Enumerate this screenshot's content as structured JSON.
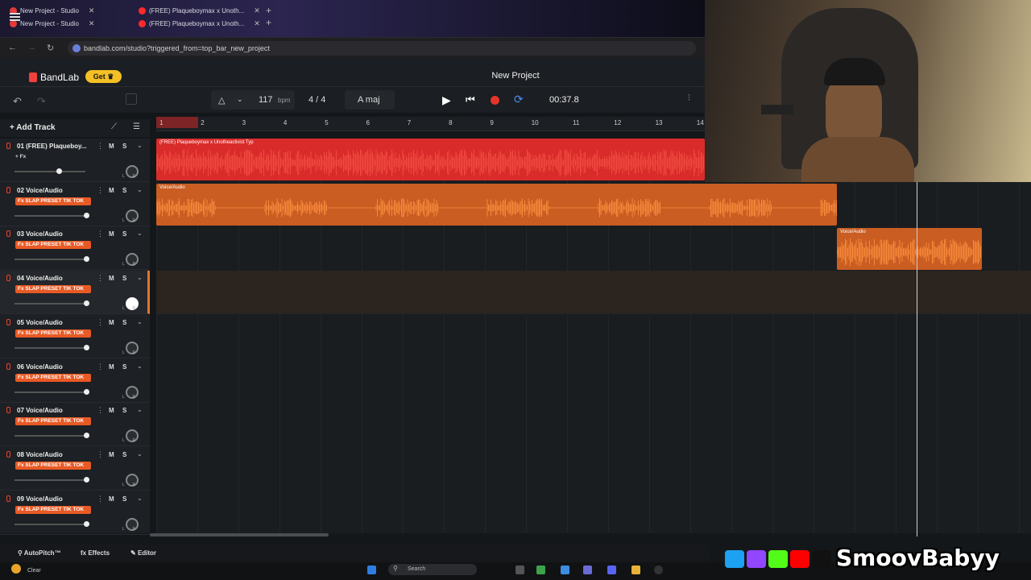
{
  "browser": {
    "tabs": [
      {
        "label": "New Project - Studio"
      },
      {
        "label": "(FREE) Plaqueboymax x Unoth..."
      },
      {
        "label": "New Project - Studio"
      },
      {
        "label": "(FREE) Plaqueboymax x Unoth..."
      }
    ],
    "url": "bandlab.com/studio?triggered_from=top_bar_new_project"
  },
  "app": {
    "logo": "BandLab",
    "get_label": "Get",
    "project_title": "New Project"
  },
  "transport": {
    "bpm": "117",
    "bpm_unit": "bpm",
    "time_signature": "4 / 4",
    "key": "A maj",
    "time": "00:37.8"
  },
  "add_track_label": "Add Track",
  "ruler": [
    "1",
    "2",
    "3",
    "4",
    "5",
    "6",
    "7",
    "8",
    "9",
    "10",
    "11",
    "12",
    "13",
    "14"
  ],
  "tracks": [
    {
      "name": "01  (FREE) Plaqueboy...",
      "fx": "+ Fx",
      "plain": true,
      "vol": 0.6
    },
    {
      "name": "02  Voice/Audio",
      "fx": "Fx SLAP PRESET TIK TOK",
      "plain": false,
      "vol": 1.0
    },
    {
      "name": "03  Voice/Audio",
      "fx": "Fx SLAP PRESET TIK TOK",
      "plain": false,
      "vol": 1.0
    },
    {
      "name": "04  Voice/Audio",
      "fx": "Fx SLAP PRESET TIK TOK",
      "plain": false,
      "vol": 1.0
    },
    {
      "name": "05  Voice/Audio",
      "fx": "Fx SLAP PRESET TIK TOK",
      "plain": false,
      "vol": 1.0
    },
    {
      "name": "06  Voice/Audio",
      "fx": "Fx SLAP PRESET TIK TOK",
      "plain": false,
      "vol": 1.0
    },
    {
      "name": "07  Voice/Audio",
      "fx": "Fx SLAP PRESET TIK TOK",
      "plain": false,
      "vol": 1.0
    },
    {
      "name": "08  Voice/Audio",
      "fx": "Fx SLAP PRESET TIK TOK",
      "plain": false,
      "vol": 1.0
    },
    {
      "name": "09  Voice/Audio",
      "fx": "Fx SLAP PRESET TIK TOK",
      "plain": false,
      "vol": 1.0
    }
  ],
  "track_buttons": {
    "mute": "M",
    "solo": "S"
  },
  "clips": [
    {
      "label": "(FREE) Plaqueboymax x Unotheactivist Typ",
      "color": "#e8302c"
    },
    {
      "label": "Voice/Audio",
      "color": "#e8732a"
    },
    {
      "label": "Voice/Audio",
      "color": "#e8732a"
    }
  ],
  "bottom": {
    "autopitch": "AutoPitch™",
    "effects": "Effects",
    "editor": "Editor"
  },
  "taskbar": {
    "weather": "Clear",
    "search": "Search"
  },
  "overlay": {
    "brand": "SmoovBabyy"
  }
}
